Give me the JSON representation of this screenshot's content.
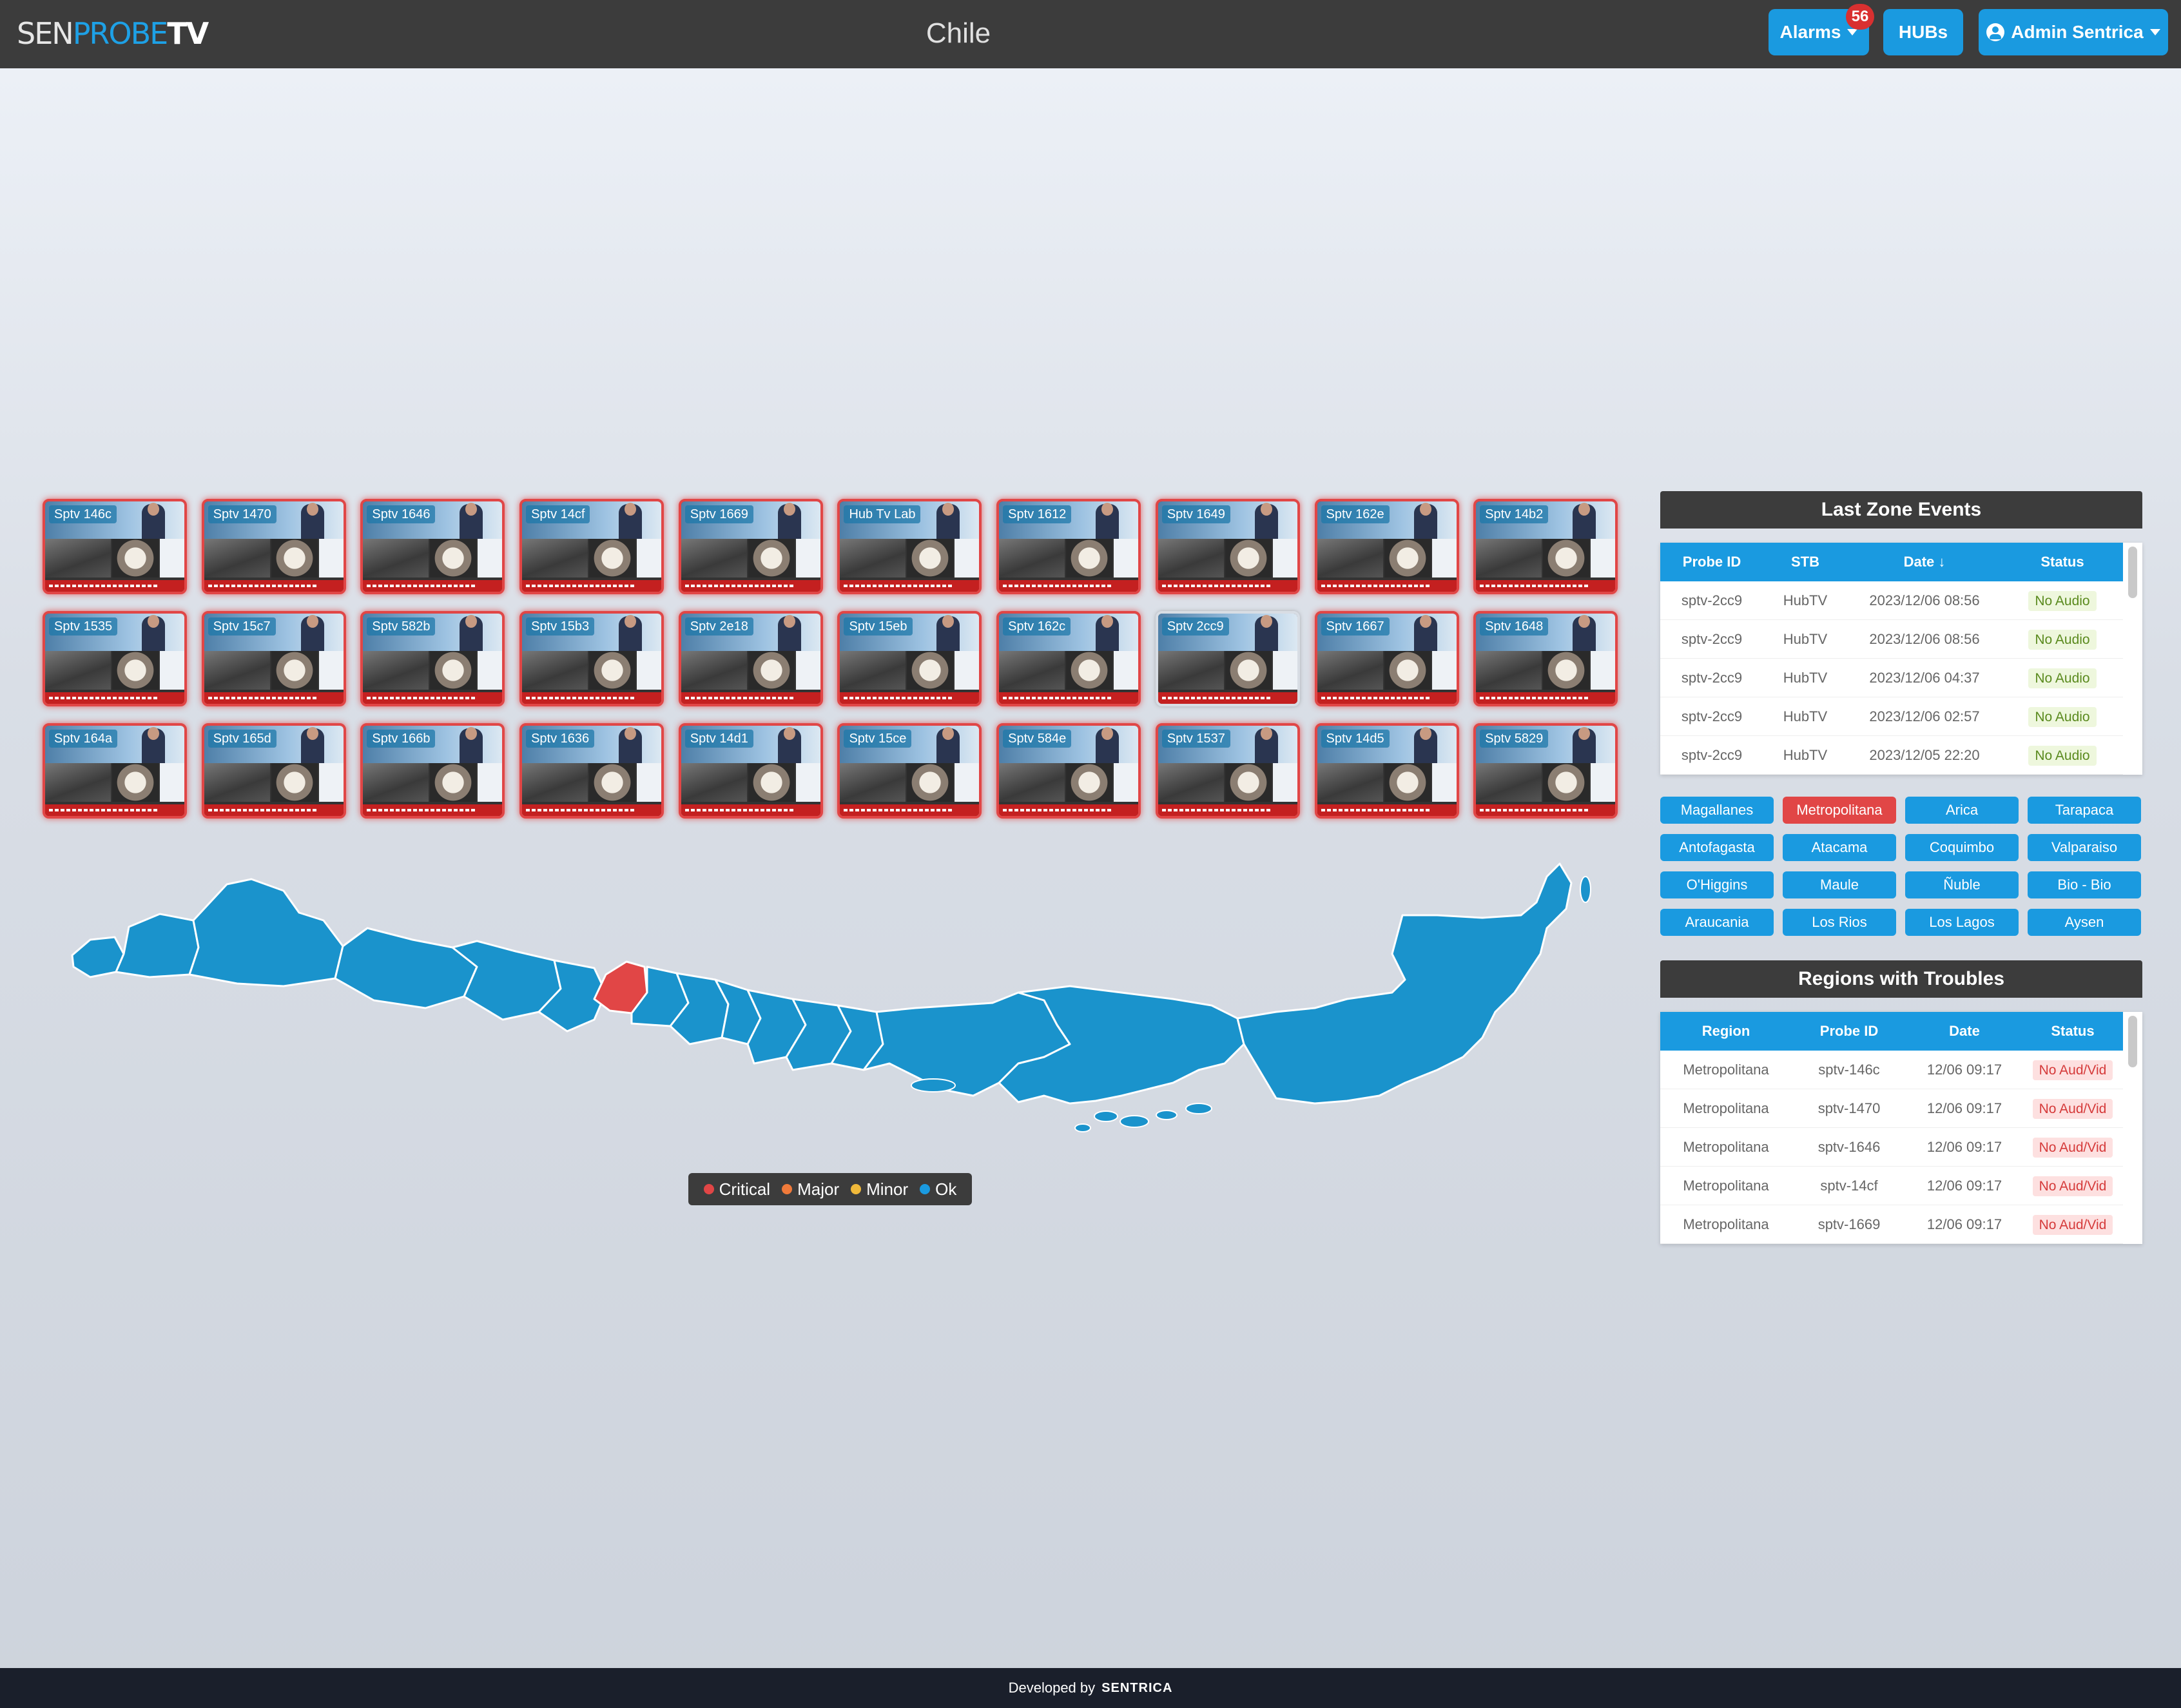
{
  "header": {
    "logo": {
      "part1": "SEN",
      "part2": "PROBE",
      "part3": "TV"
    },
    "title": "Chile",
    "alarms_label": "Alarms",
    "alarms_count": "56",
    "hubs_label": "HUBs",
    "user_label": "Admin Sentrica"
  },
  "probes": [
    {
      "label": "Sptv 146c",
      "state": "critical"
    },
    {
      "label": "Sptv 1470",
      "state": "critical"
    },
    {
      "label": "Sptv 1646",
      "state": "critical"
    },
    {
      "label": "Sptv 14cf",
      "state": "critical"
    },
    {
      "label": "Sptv 1669",
      "state": "critical"
    },
    {
      "label": "Hub Tv Lab",
      "state": "critical"
    },
    {
      "label": "Sptv 1612",
      "state": "critical"
    },
    {
      "label": "Sptv 1649",
      "state": "critical"
    },
    {
      "label": "Sptv 162e",
      "state": "critical"
    },
    {
      "label": "Sptv 14b2",
      "state": "critical"
    },
    {
      "label": "Sptv 1535",
      "state": "critical"
    },
    {
      "label": "Sptv 15c7",
      "state": "critical"
    },
    {
      "label": "Sptv 582b",
      "state": "critical"
    },
    {
      "label": "Sptv 15b3",
      "state": "critical"
    },
    {
      "label": "Sptv 2e18",
      "state": "critical"
    },
    {
      "label": "Sptv 15eb",
      "state": "critical"
    },
    {
      "label": "Sptv 162c",
      "state": "critical"
    },
    {
      "label": "Sptv 2cc9",
      "state": "ok"
    },
    {
      "label": "Sptv 1667",
      "state": "critical"
    },
    {
      "label": "Sptv 1648",
      "state": "critical"
    },
    {
      "label": "Sptv 164a",
      "state": "critical"
    },
    {
      "label": "Sptv 165d",
      "state": "critical"
    },
    {
      "label": "Sptv 166b",
      "state": "critical"
    },
    {
      "label": "Sptv 1636",
      "state": "critical"
    },
    {
      "label": "Sptv 14d1",
      "state": "critical"
    },
    {
      "label": "Sptv 15ce",
      "state": "critical"
    },
    {
      "label": "Sptv 584e",
      "state": "critical"
    },
    {
      "label": "Sptv 1537",
      "state": "critical"
    },
    {
      "label": "Sptv 14d5",
      "state": "critical"
    },
    {
      "label": "Sptv 5829",
      "state": "critical"
    }
  ],
  "legend": [
    {
      "label": "Critical",
      "color": "#e14646"
    },
    {
      "label": "Major",
      "color": "#f07a3a"
    },
    {
      "label": "Minor",
      "color": "#f0b93a"
    },
    {
      "label": "Ok",
      "color": "#1a9ae0"
    }
  ],
  "map_colors": {
    "ok": "#1a93cc",
    "critical": "#e14646"
  },
  "last_zone_events": {
    "title": "Last Zone Events",
    "columns": [
      "Probe ID",
      "STB",
      "Date ↓",
      "Status"
    ],
    "rows": [
      [
        "sptv-2cc9",
        "HubTV",
        "2023/12/06 08:56",
        "No Audio"
      ],
      [
        "sptv-2cc9",
        "HubTV",
        "2023/12/06 08:56",
        "No Audio"
      ],
      [
        "sptv-2cc9",
        "HubTV",
        "2023/12/06 04:37",
        "No Audio"
      ],
      [
        "sptv-2cc9",
        "HubTV",
        "2023/12/06 02:57",
        "No Audio"
      ],
      [
        "sptv-2cc9",
        "HubTV",
        "2023/12/05 22:20",
        "No Audio"
      ]
    ]
  },
  "regions": [
    {
      "label": "Magallanes",
      "active": false
    },
    {
      "label": "Metropolitana",
      "active": true
    },
    {
      "label": "Arica",
      "active": false
    },
    {
      "label": "Tarapaca",
      "active": false
    },
    {
      "label": "Antofagasta",
      "active": false
    },
    {
      "label": "Atacama",
      "active": false
    },
    {
      "label": "Coquimbo",
      "active": false
    },
    {
      "label": "Valparaiso",
      "active": false
    },
    {
      "label": "O'Higgins",
      "active": false
    },
    {
      "label": "Maule",
      "active": false
    },
    {
      "label": "Ñuble",
      "active": false
    },
    {
      "label": "Bio - Bio",
      "active": false
    },
    {
      "label": "Araucania",
      "active": false
    },
    {
      "label": "Los Rios",
      "active": false
    },
    {
      "label": "Los Lagos",
      "active": false
    },
    {
      "label": "Aysen",
      "active": false
    }
  ],
  "regions_with_troubles": {
    "title": "Regions with Troubles",
    "columns": [
      "Region",
      "Probe ID",
      "Date",
      "Status"
    ],
    "rows": [
      [
        "Metropolitana",
        "sptv-146c",
        "12/06 09:17",
        "No Aud/Vid"
      ],
      [
        "Metropolitana",
        "sptv-1470",
        "12/06 09:17",
        "No Aud/Vid"
      ],
      [
        "Metropolitana",
        "sptv-1646",
        "12/06 09:17",
        "No Aud/Vid"
      ],
      [
        "Metropolitana",
        "sptv-14cf",
        "12/06 09:17",
        "No Aud/Vid"
      ],
      [
        "Metropolitana",
        "sptv-1669",
        "12/06 09:17",
        "No Aud/Vid"
      ]
    ]
  },
  "footer": {
    "text": "Developed by",
    "brand": "SENTRICA"
  }
}
